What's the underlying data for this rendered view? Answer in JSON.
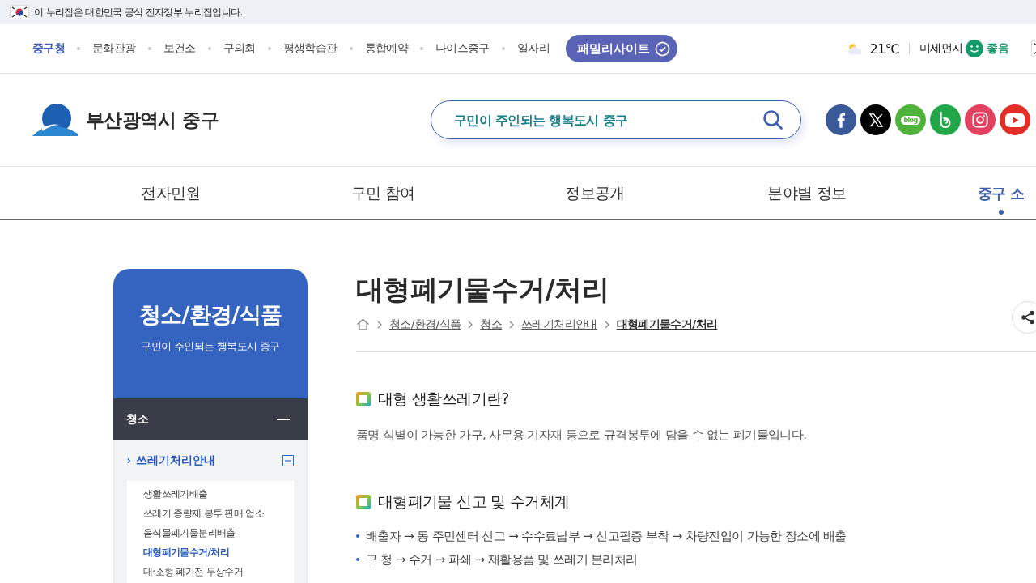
{
  "gov_banner": {
    "text": "이 누리집은 대한민국 공식 전자정부 누리집입니다."
  },
  "site_links": [
    {
      "label": "중구청",
      "selected": true
    },
    {
      "label": "문화관광",
      "selected": false
    },
    {
      "label": "보건소",
      "selected": false
    },
    {
      "label": "구의회",
      "selected": false
    },
    {
      "label": "평생학습관",
      "selected": false
    },
    {
      "label": "통합예약",
      "selected": false
    },
    {
      "label": "나이스중구",
      "selected": false
    },
    {
      "label": "일자리",
      "selected": false
    }
  ],
  "family_site": {
    "label": "패밀리사이트"
  },
  "weather": {
    "temperature": "21℃",
    "dust_label": "미세먼지",
    "dust_status": "좋음"
  },
  "header": {
    "logo": "부산광역시 중구",
    "search": {
      "placeholder": "구민이 주인되는 행복도시 중구"
    },
    "social": [
      {
        "kind": "facebook"
      },
      {
        "kind": "x"
      },
      {
        "kind": "blog",
        "label": "blog"
      },
      {
        "kind": "band"
      },
      {
        "kind": "instagram"
      },
      {
        "kind": "youtube"
      }
    ]
  },
  "gnb": [
    {
      "label": "전자민원",
      "selected": false
    },
    {
      "label": "구민 참여",
      "selected": false
    },
    {
      "label": "정보공개",
      "selected": false
    },
    {
      "label": "분야별 정보",
      "selected": false
    },
    {
      "label": "중구 소",
      "selected": true
    }
  ],
  "sidebar": {
    "title": "청소/환경/식품",
    "subtitle": "구민이 주인되는 행복도시 중구",
    "section": {
      "label": "청소",
      "expanded": true
    },
    "group": {
      "label": "쓰레기처리안내",
      "expanded": true
    },
    "items": [
      {
        "label": "생활쓰레기배출",
        "selected": false
      },
      {
        "label": "쓰레기 종량제 봉투 판매 업소",
        "selected": false
      },
      {
        "label": "음식물폐기물분리배출",
        "selected": false
      },
      {
        "label": "대형폐기물수거/처리",
        "selected": true
      },
      {
        "label": "대·소형 폐가전 무상수거",
        "selected": false
      }
    ]
  },
  "page": {
    "title": "대형폐기물수거/처리",
    "breadcrumb": [
      "청소/환경/식품",
      "청소",
      "쓰레기처리안내",
      "대형폐기물수거/처리"
    ],
    "sections": [
      {
        "kind": "paragraph",
        "heading": "대형 생활쓰레기란?",
        "text": "품명 식별이 가능한 가구, 사무용 기자재 등으로 규격봉투에 담을 수 없는 폐기물입니다."
      },
      {
        "kind": "list",
        "heading": "대형폐기물 신고 및 수거체계",
        "items": [
          "배출자 → 동 주민센터 신고 → 수수료납부 → 신고필증 부착 → 차량진입이 가능한 장소에 배출",
          "구 청 → 수거 → 파쇄 → 재활용품 및 쓰레기 분리처리"
        ]
      }
    ]
  }
}
